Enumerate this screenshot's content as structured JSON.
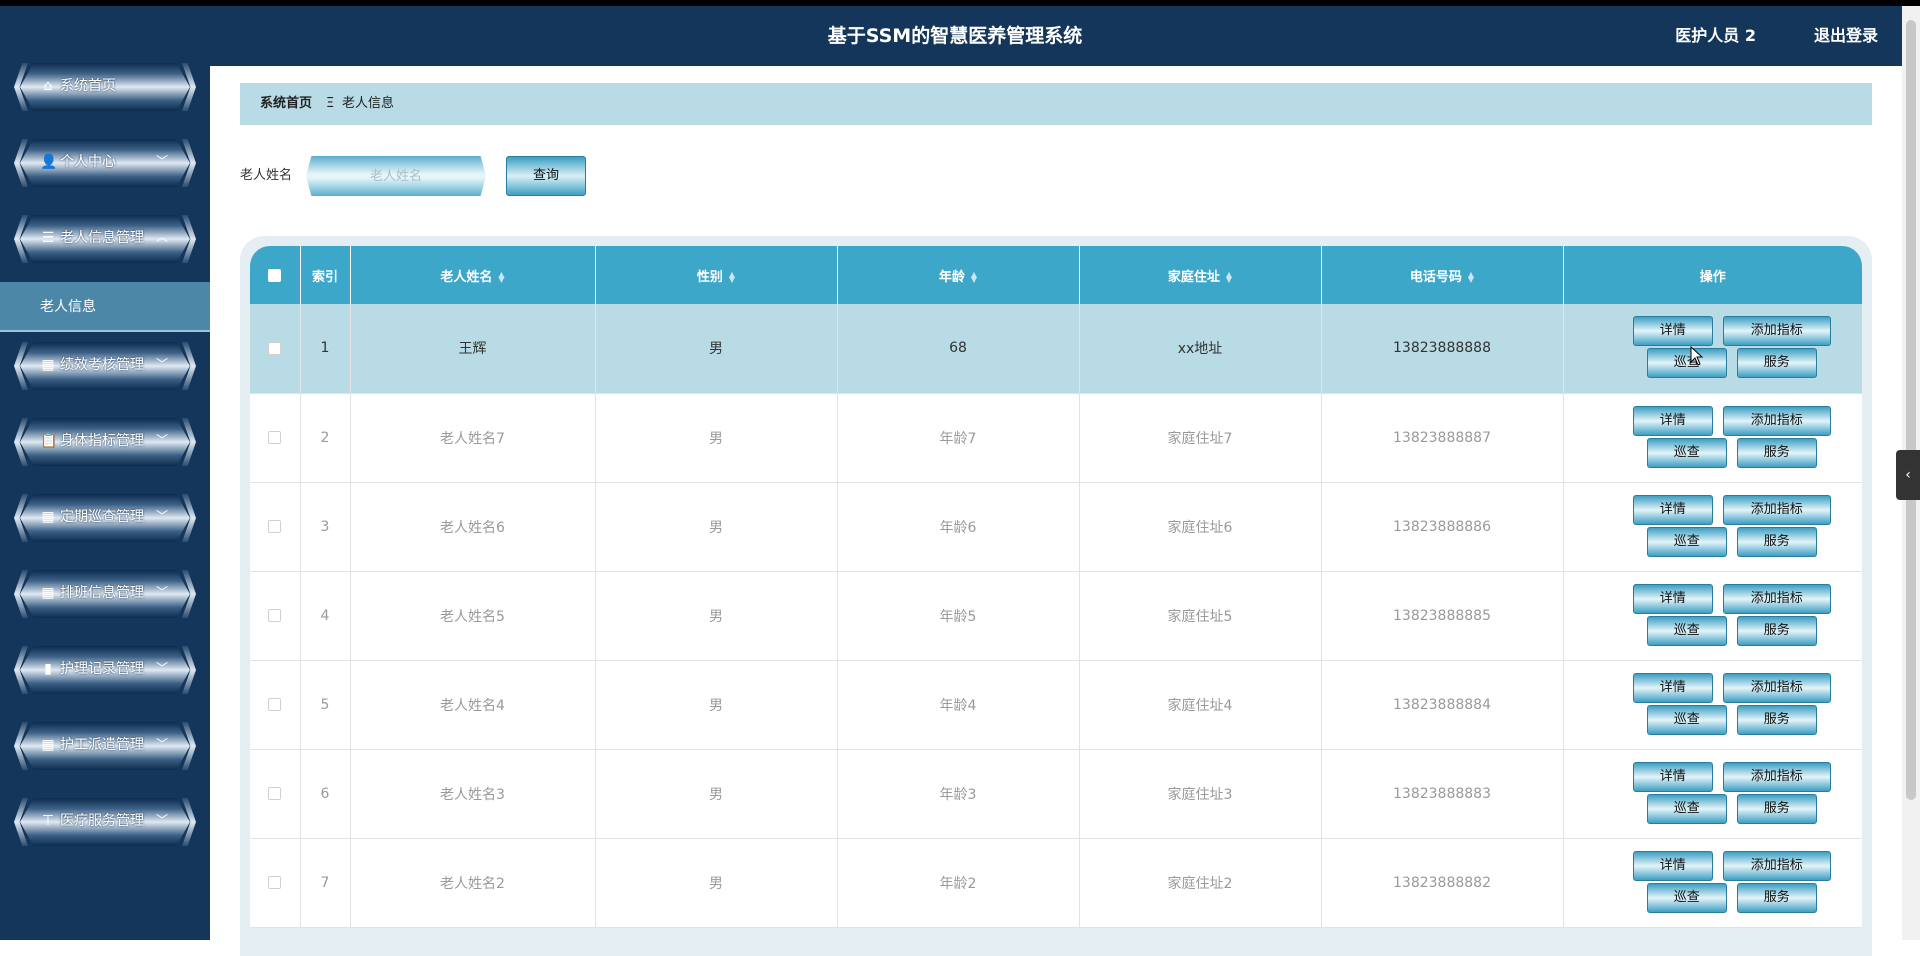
{
  "header": {
    "title": "基于SSM的智慧医养管理系统",
    "user": "医护人员 2",
    "logout": "退出登录"
  },
  "sidebar": {
    "items": [
      {
        "label": "系统首页",
        "icon": "home-icon",
        "expandable": false
      },
      {
        "label": "个人中心",
        "icon": "user-icon",
        "expandable": true
      },
      {
        "label": "老人信息管理",
        "icon": "list-icon",
        "expandable": true,
        "expanded": true
      },
      {
        "label": "绩效考核管理",
        "icon": "grid-icon",
        "expandable": true
      },
      {
        "label": "身体指标管理",
        "icon": "clipboard-icon",
        "expandable": true
      },
      {
        "label": "定期巡查管理",
        "icon": "grid-icon",
        "expandable": true
      },
      {
        "label": "排班信息管理",
        "icon": "grid-icon",
        "expandable": true
      },
      {
        "label": "护理记录管理",
        "icon": "bar-chart-icon",
        "expandable": true
      },
      {
        "label": "护工派遣管理",
        "icon": "grid-icon",
        "expandable": true
      },
      {
        "label": "医疗服务管理",
        "icon": "stamp-icon",
        "expandable": true
      }
    ],
    "subitem": "老人信息"
  },
  "breadcrumb": {
    "home": "系统首页",
    "separator": "Ξ",
    "current": "老人信息"
  },
  "search": {
    "label": "老人姓名",
    "placeholder": "老人姓名",
    "button": "查询"
  },
  "table": {
    "columns": [
      "索引",
      "老人姓名",
      "性别",
      "年龄",
      "家庭住址",
      "电话号码",
      "操作"
    ],
    "sortable": [
      false,
      true,
      true,
      true,
      true,
      true,
      false
    ],
    "actions": {
      "detail": "详情",
      "add_indicator": "添加指标",
      "patrol": "巡查",
      "service": "服务"
    },
    "rows": [
      {
        "index": "1",
        "name": "王辉",
        "gender": "男",
        "age": "68",
        "address": "xx地址",
        "phone": "13823888888",
        "highlighted": true
      },
      {
        "index": "2",
        "name": "老人姓名7",
        "gender": "男",
        "age": "年龄7",
        "address": "家庭住址7",
        "phone": "13823888887"
      },
      {
        "index": "3",
        "name": "老人姓名6",
        "gender": "男",
        "age": "年龄6",
        "address": "家庭住址6",
        "phone": "13823888886"
      },
      {
        "index": "4",
        "name": "老人姓名5",
        "gender": "男",
        "age": "年龄5",
        "address": "家庭住址5",
        "phone": "13823888885"
      },
      {
        "index": "5",
        "name": "老人姓名4",
        "gender": "男",
        "age": "年龄4",
        "address": "家庭住址4",
        "phone": "13823888884"
      },
      {
        "index": "6",
        "name": "老人姓名3",
        "gender": "男",
        "age": "年龄3",
        "address": "家庭住址3",
        "phone": "13823888883"
      },
      {
        "index": "7",
        "name": "老人姓名2",
        "gender": "男",
        "age": "年龄2",
        "address": "家庭住址2",
        "phone": "13823888882"
      }
    ]
  },
  "colors": {
    "sidebar_bg": "#14365a",
    "header_bg": "#14365a",
    "breadcrumb_bg": "#b9dbe5",
    "table_header_bg": "#3da7c9",
    "highlight_row_bg": "#b9dbe5",
    "submenu_bg": "#4d87a8"
  }
}
